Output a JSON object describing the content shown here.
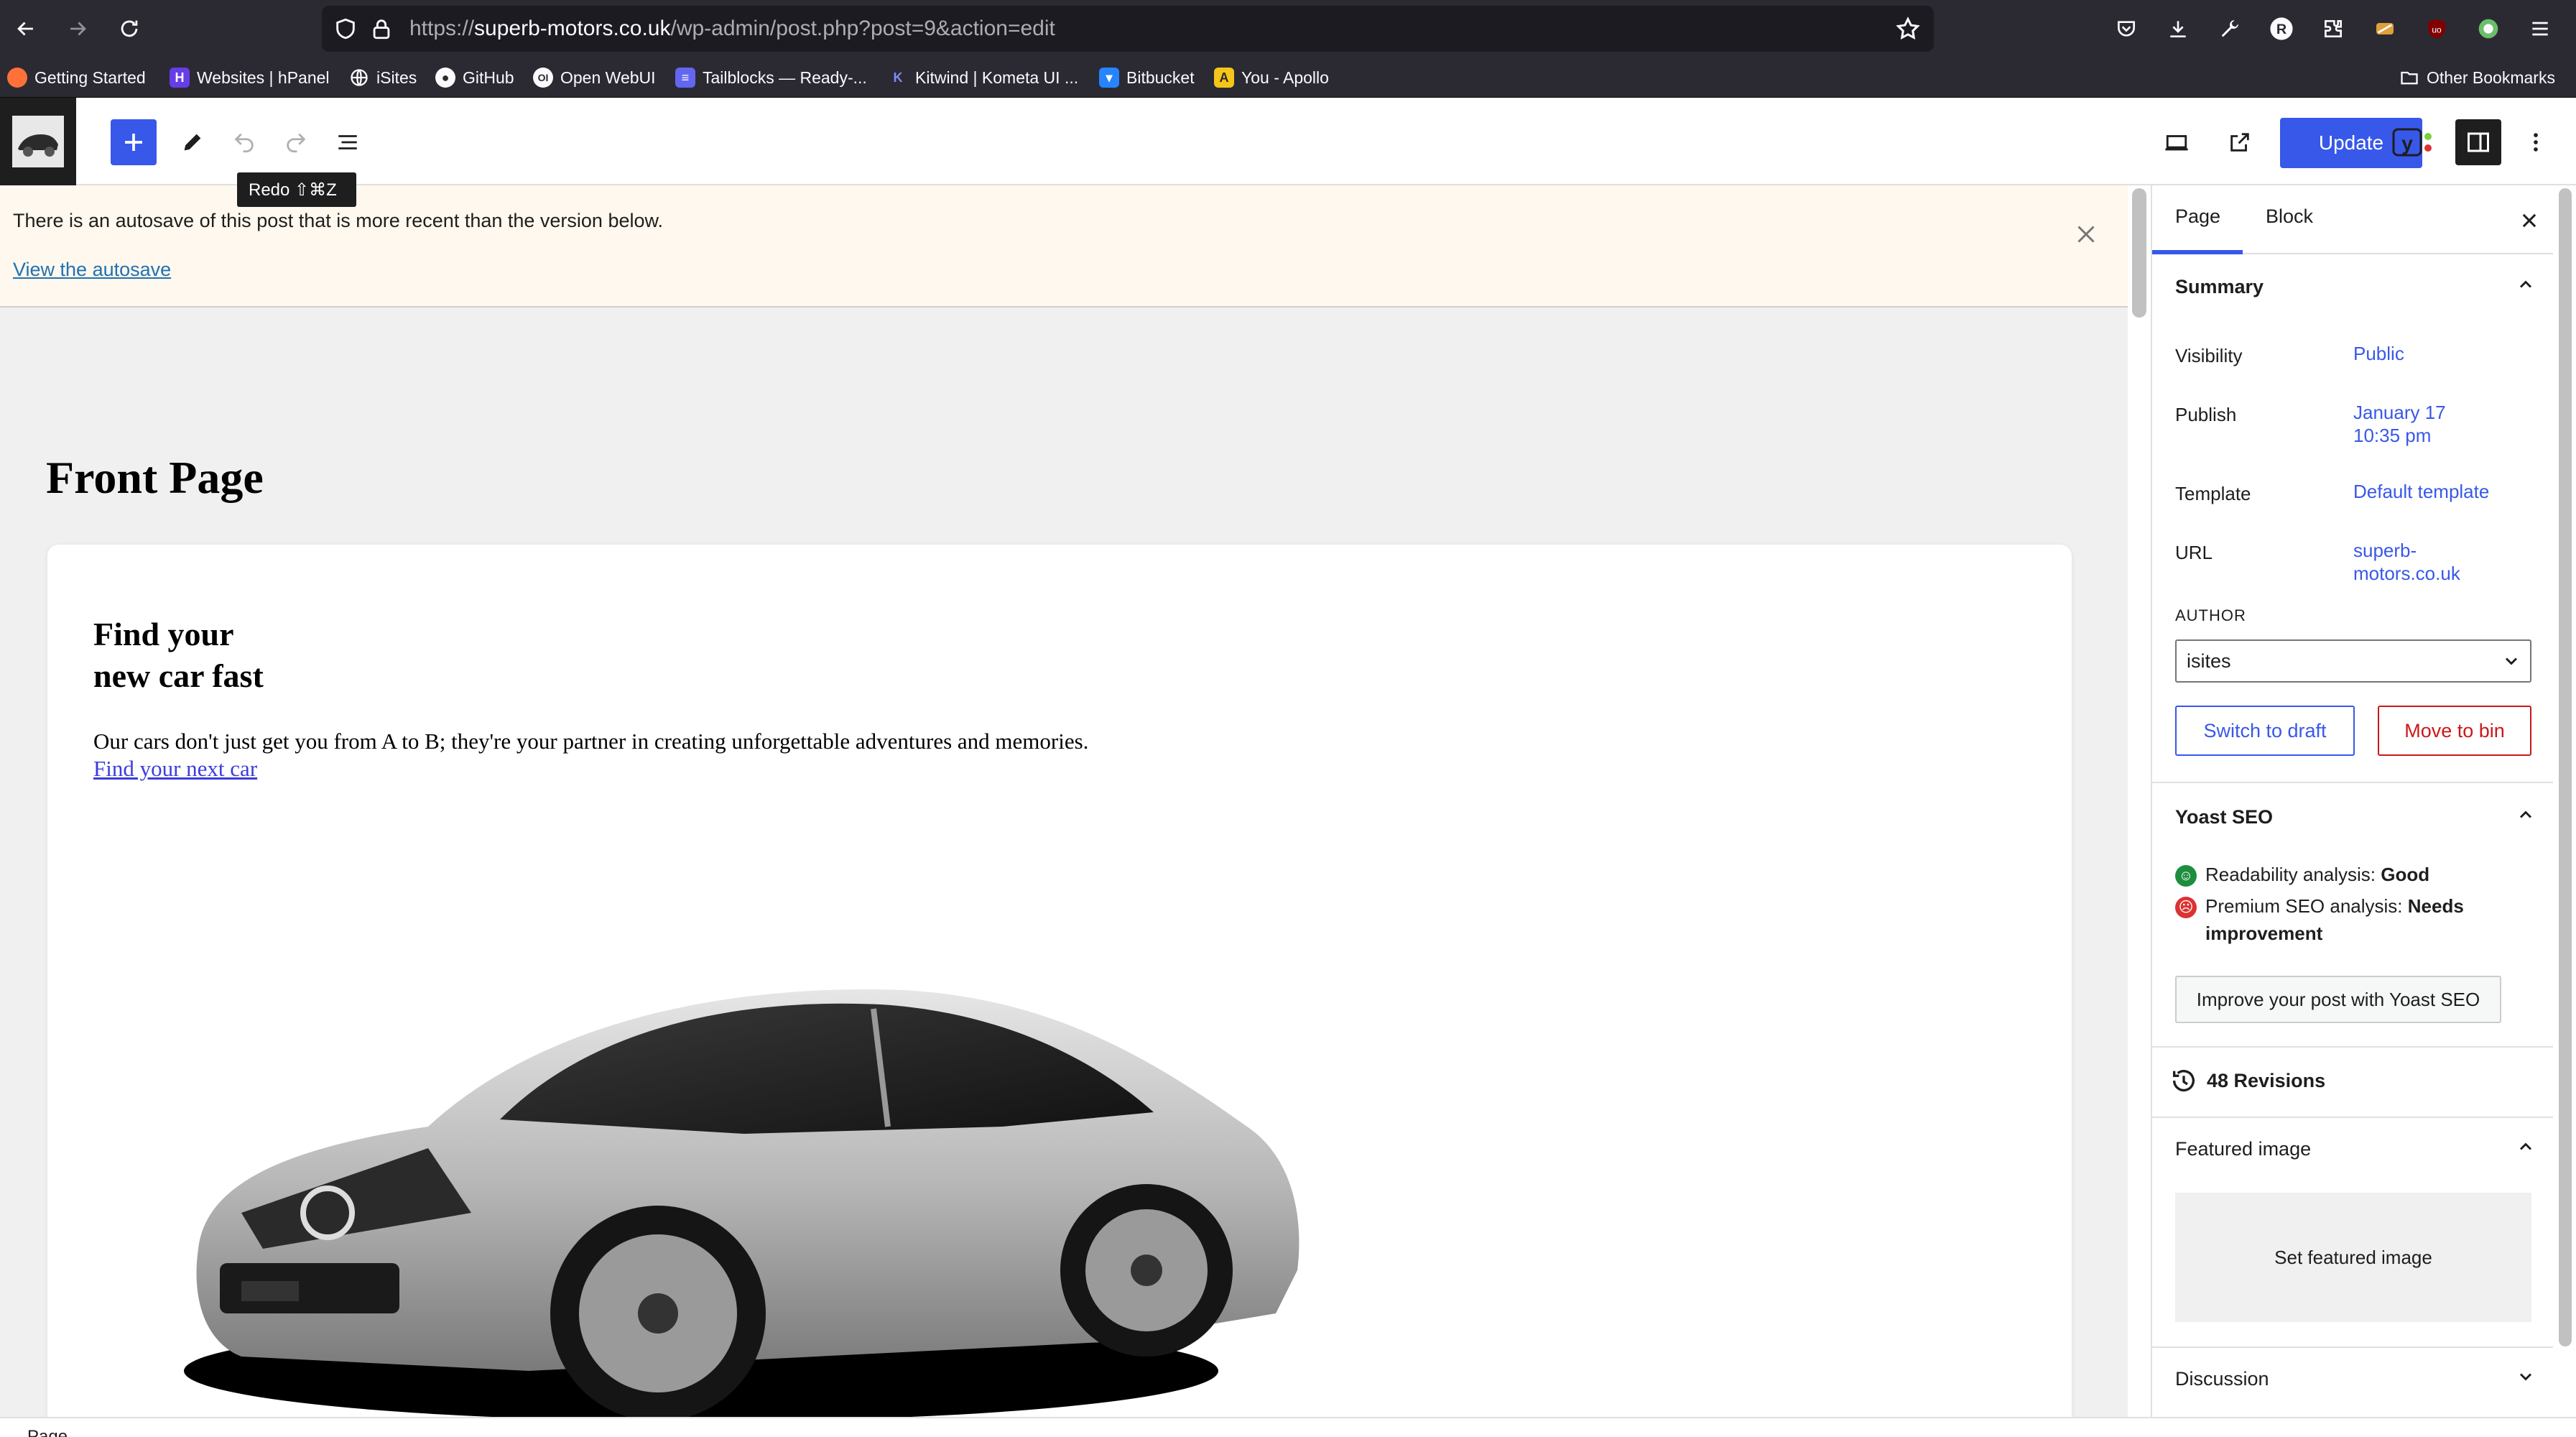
{
  "browser": {
    "url_scheme": "https://",
    "url_domain": "superb-motors.co.uk",
    "url_path": "/wp-admin/post.php?post=9&action=edit",
    "bookmarks": [
      {
        "label": "Getting Started",
        "icon": "firefox-icon",
        "color": "#ff7139"
      },
      {
        "label": "Websites | hPanel",
        "icon": "hostinger-icon",
        "color": "#673de6"
      },
      {
        "label": "iSites",
        "icon": "globe-icon",
        "color": "#fbfbfe"
      },
      {
        "label": "GitHub",
        "icon": "github-icon",
        "color": "#fbfbfe"
      },
      {
        "label": "Open WebUI",
        "icon": "openwebui-icon",
        "color": "#fbfbfe"
      },
      {
        "label": "Tailblocks — Ready-...",
        "icon": "tailblocks-icon",
        "color": "#6366f1"
      },
      {
        "label": "Kitwind | Kometa UI ...",
        "icon": "kitwind-icon",
        "color": "#5a67d8"
      },
      {
        "label": "Bitbucket",
        "icon": "bitbucket-icon",
        "color": "#2684ff"
      },
      {
        "label": "You - Apollo",
        "icon": "apollo-icon",
        "color": "#f5c518"
      }
    ],
    "other_bookmarks": "Other Bookmarks"
  },
  "editor": {
    "update_label": "Update",
    "redo_tooltip": "Redo ⇧⌘Z"
  },
  "notice": {
    "text": "There is an autosave of this post that is more recent than the version below.",
    "link": "View the autosave"
  },
  "post": {
    "title": "Front Page",
    "hero_heading_line1": "Find your",
    "hero_heading_line2": "new car fast",
    "hero_paragraph": "Our cars don't just get you from A to B; they're your partner in creating unforgettable adventures and memories.",
    "hero_link": "Find your next car"
  },
  "sidebar": {
    "tab_page": "Page",
    "tab_block": "Block",
    "summary_title": "Summary",
    "visibility_label": "Visibility",
    "visibility_value": "Public",
    "publish_label": "Publish",
    "publish_date": "January 17",
    "publish_time": "10:35 pm",
    "template_label": "Template",
    "template_value": "Default template",
    "url_label": "URL",
    "url_line1": "superb-",
    "url_line2": "motors.co.uk",
    "author_label": "AUTHOR",
    "author_value": "isites",
    "switch_draft": "Switch to draft",
    "move_bin": "Move to bin",
    "yoast_title": "Yoast SEO",
    "readability_label": "Readability analysis: ",
    "readability_value": "Good",
    "seo_label": "Premium SEO analysis: ",
    "seo_value": "Needs improvement",
    "improve_btn": "Improve your post with Yoast SEO",
    "revisions": "48 Revisions",
    "featured_title": "Featured image",
    "featured_btn": "Set featured image",
    "discussion_title": "Discussion"
  },
  "status": {
    "breadcrumb": "Page"
  },
  "colors": {
    "accent": "#3858e9",
    "danger": "#cc1818",
    "good": "#1e8e3e",
    "bad": "#dc3232"
  }
}
